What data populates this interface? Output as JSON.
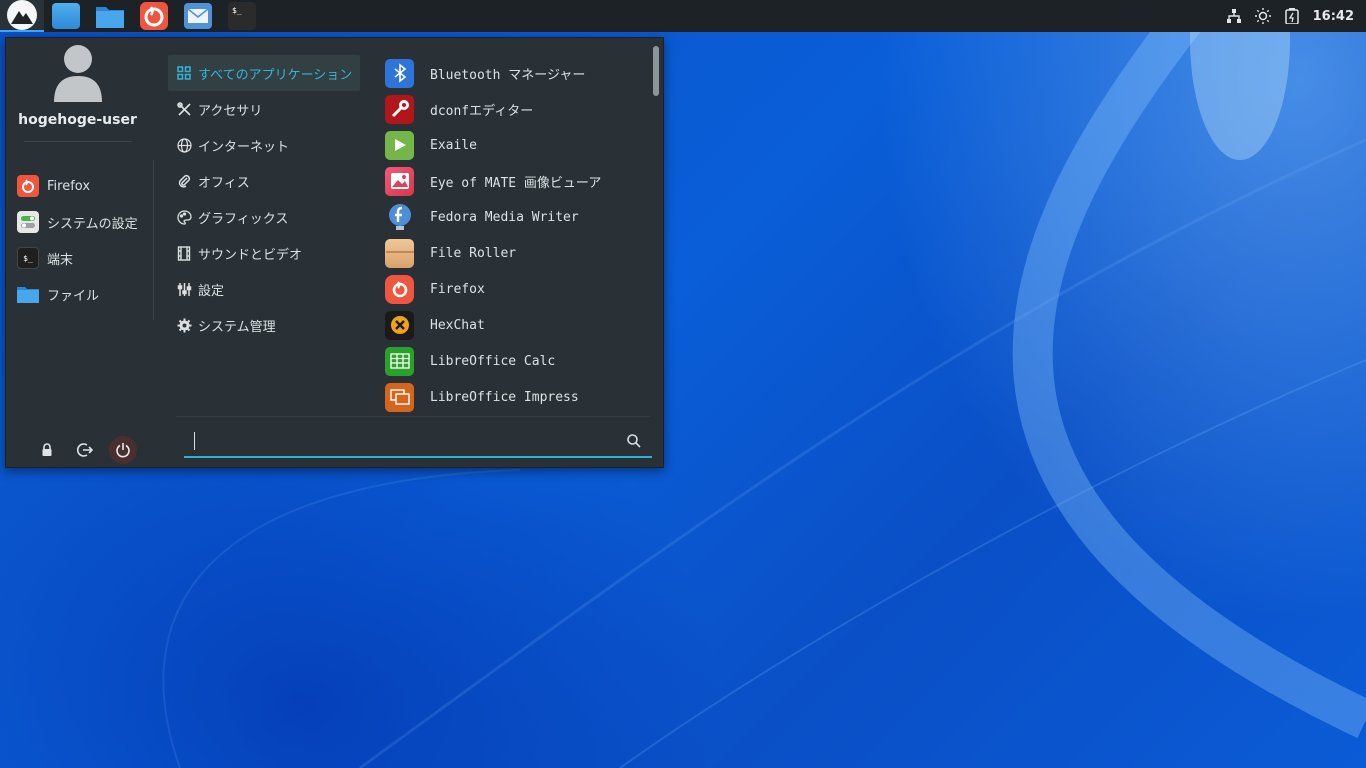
{
  "panel": {
    "launcher_icon": "distro-logo-icon",
    "apps": [
      {
        "name": "show-desktop",
        "icon": "desktop-icon",
        "color": "#3aa0e8"
      },
      {
        "name": "files",
        "icon": "folder-icon",
        "color": "#3a9de6"
      },
      {
        "name": "firefox",
        "icon": "firefox-icon",
        "color": "#f0563f"
      },
      {
        "name": "mail",
        "icon": "mail-icon",
        "color": "#5b9fe0"
      },
      {
        "name": "terminal",
        "icon": "terminal-icon",
        "color": "#2a2a2a"
      }
    ],
    "tray": {
      "network_icon": "network-icon",
      "brightness_icon": "brightness-icon",
      "battery_icon": "battery-icon",
      "clock": "16:42"
    }
  },
  "menu": {
    "username": "hogehoge-user",
    "favorites": [
      {
        "label": "Firefox",
        "icon": "firefox-icon"
      },
      {
        "label": "システムの設定",
        "icon": "settings-toggle-icon"
      },
      {
        "label": "端末",
        "icon": "terminal-icon"
      },
      {
        "label": "ファイル",
        "icon": "folder-icon"
      }
    ],
    "session_buttons": [
      {
        "name": "lock",
        "icon": "lock-icon"
      },
      {
        "name": "logout",
        "icon": "logout-icon"
      },
      {
        "name": "power",
        "icon": "power-icon"
      }
    ],
    "categories": [
      {
        "label": "すべてのアプリケーション",
        "icon": "grid-icon",
        "selected": true
      },
      {
        "label": "アクセサリ",
        "icon": "tools-icon"
      },
      {
        "label": "インターネット",
        "icon": "globe-icon"
      },
      {
        "label": "オフィス",
        "icon": "paperclip-icon"
      },
      {
        "label": "グラフィックス",
        "icon": "palette-icon"
      },
      {
        "label": "サウンドとビデオ",
        "icon": "film-icon"
      },
      {
        "label": "設定",
        "icon": "sliders-icon"
      },
      {
        "label": "システム管理",
        "icon": "gear-icon"
      }
    ],
    "apps": [
      {
        "label": "Bluetooth マネージャー",
        "icon": "bluetooth-icon"
      },
      {
        "label": "dconfエディター",
        "icon": "dconf-icon"
      },
      {
        "label": "Exaile",
        "icon": "play-icon"
      },
      {
        "label": "Eye of MATE 画像ビューア",
        "icon": "image-viewer-icon"
      },
      {
        "label": "Fedora Media Writer",
        "icon": "fedora-icon"
      },
      {
        "label": "File Roller",
        "icon": "archive-icon"
      },
      {
        "label": "Firefox",
        "icon": "firefox-icon"
      },
      {
        "label": "HexChat",
        "icon": "hexchat-icon"
      },
      {
        "label": "LibreOffice Calc",
        "icon": "calc-icon"
      },
      {
        "label": "LibreOffice Impress",
        "icon": "impress-icon"
      }
    ],
    "search": {
      "value": "",
      "placeholder": "",
      "icon": "search-icon"
    }
  }
}
